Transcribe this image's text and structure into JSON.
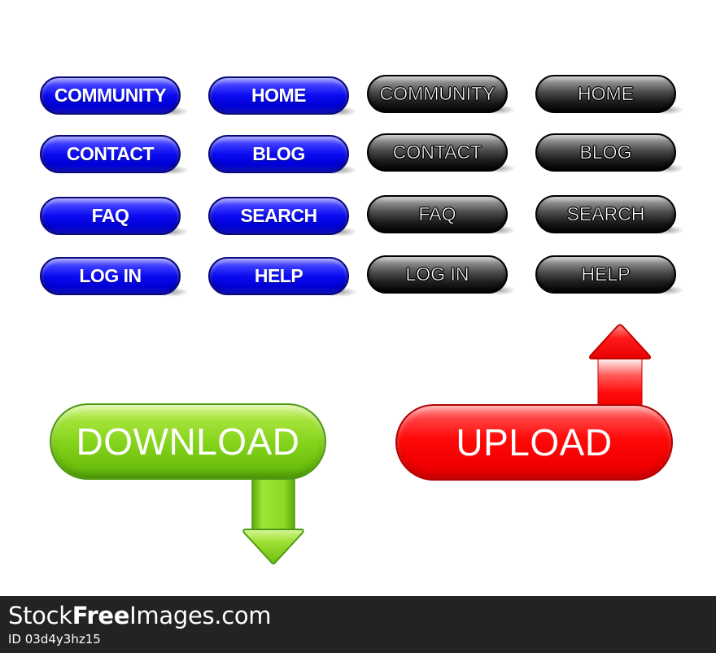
{
  "blue_buttons": [
    {
      "label": "COMMUNITY"
    },
    {
      "label": "HOME"
    },
    {
      "label": "CONTACT"
    },
    {
      "label": "BLOG"
    },
    {
      "label": "FAQ"
    },
    {
      "label": "SEARCH"
    },
    {
      "label": "LOG IN"
    },
    {
      "label": "HELP"
    }
  ],
  "black_buttons": [
    {
      "label": "COMMUNITY"
    },
    {
      "label": "HOME"
    },
    {
      "label": "CONTACT"
    },
    {
      "label": "BLOG"
    },
    {
      "label": "FAQ"
    },
    {
      "label": "SEARCH"
    },
    {
      "label": "LOG IN"
    },
    {
      "label": "HELP"
    }
  ],
  "download_button": {
    "label": "DOWNLOAD",
    "icon": "arrow-down-icon",
    "color": "#86d41c"
  },
  "upload_button": {
    "label": "UPLOAD",
    "icon": "arrow-up-icon",
    "color": "#ff0808"
  },
  "colors": {
    "blue": "#0b0bf0",
    "black": "#1a1a1a",
    "footer_bg": "#232323"
  },
  "footer": {
    "brand_prefix": "Stock",
    "brand_bold": "Free",
    "brand_suffix": "Images.com",
    "image_id": "ID 03d4y3hz15"
  }
}
